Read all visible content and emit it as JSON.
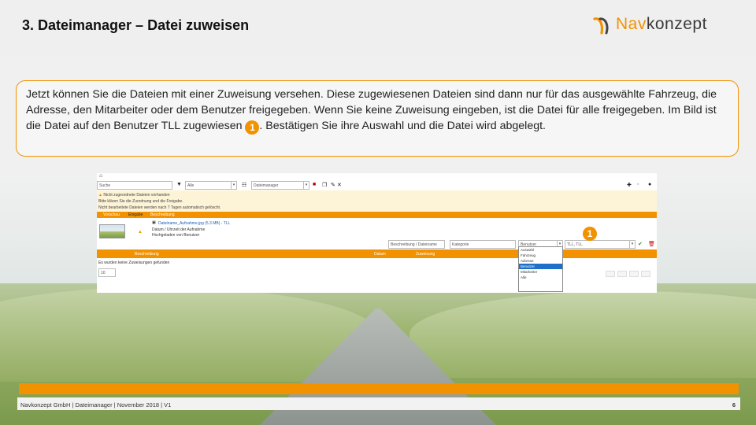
{
  "slide": {
    "title": "3. Dateimanager – Datei zuweisen",
    "logo": {
      "nav": "Nav",
      "rest": "konzept"
    },
    "callout": {
      "text_before": "Jetzt können Sie die Dateien mit einer Zuweisung versehen. Diese zugewiesenen Dateien sind dann nur für das ausgewählte Fahrzeug, die Adresse, den Mitarbeiter oder dem Benutzer freigegeben. Wenn Sie keine Zuweisung eingeben, ist die Datei für alle freigegeben. Im Bild ist die Datei auf den Benutzer TLL zugewiesen ",
      "badge": "1",
      "text_after": ". Bestätigen Sie ihre Auswahl und die Datei wird abgelegt."
    },
    "footer": {
      "text": "Navkonzept GmbH  |  Dateimanager  |  November 2018  |  V1",
      "page": "6"
    },
    "colors": {
      "accent": "#f39200"
    }
  },
  "screenshot": {
    "toolbar": {
      "search_placeholder": "Suche",
      "filter_value": "Alle",
      "category_value": "Dateimanager"
    },
    "warning": {
      "line1": "Nicht zugeordnete Dateien vorhanden",
      "line2": "Bitte klären Sie die Zuordnung und die Freigabe.",
      "line3": "Nicht bearbeitete Dateien werden nach 7 Tagen automatisch gelöscht."
    },
    "tabs": [
      "Vorschau",
      "Eingabe",
      "Beschreibung"
    ],
    "file": {
      "name": "Dateiname_Aufnahme.jpg (5.3 MB) - TLL",
      "line2": "Datum / Uhrzeit der Aufnahme",
      "line3": "Hochgeladen von Benutzer"
    },
    "assign": {
      "field1": "Beschreibung / Dateiname",
      "field2": "Kategorie",
      "type_value": "Benutzer",
      "user_value": "TLL, TLL",
      "badge": "1"
    },
    "dropdown_options": [
      "Auswahl",
      "Fahrzeug",
      "Adresse",
      "Benutzer",
      "Mitarbeiter",
      "Alle"
    ],
    "dropdown_selected_index": 3,
    "columns": [
      "Beschreibung",
      "Datum",
      "Zuweisung"
    ],
    "empty_text": "Es wurden keine Zuweisungen gefunden",
    "page_size": "10"
  }
}
